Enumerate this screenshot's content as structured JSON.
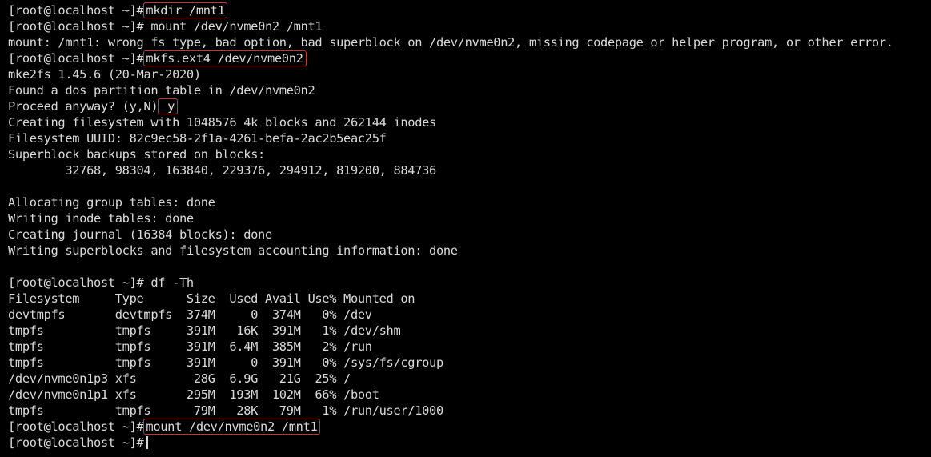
{
  "terminal": {
    "prompt": "[root@localhost ~]#",
    "lines": [
      {
        "type": "cmd",
        "text": "mkdir /mnt1",
        "highlight": true
      },
      {
        "type": "cmd",
        "text": "mount /dev/nvme0n2 /mnt1",
        "highlight": false
      },
      {
        "type": "out",
        "text": "mount: /mnt1: wrong fs type, bad option, bad superblock on /dev/nvme0n2, missing codepage or helper program, or other error."
      },
      {
        "type": "cmd",
        "text": "mkfs.ext4 /dev/nvme0n2",
        "highlight": true
      },
      {
        "type": "out",
        "text": "mke2fs 1.45.6 (20-Mar-2020)"
      },
      {
        "type": "out",
        "text": "Found a dos partition table in /dev/nvme0n2"
      },
      {
        "type": "ask",
        "text": "Proceed anyway? (y,N)",
        "answer": "y"
      },
      {
        "type": "out",
        "text": "Creating filesystem with 1048576 4k blocks and 262144 inodes"
      },
      {
        "type": "out",
        "text": "Filesystem UUID: 82c9ec58-2f1a-4261-befa-2ac2b5eac25f"
      },
      {
        "type": "out",
        "text": "Superblock backups stored on blocks:"
      },
      {
        "type": "out",
        "text": "        32768, 98304, 163840, 229376, 294912, 819200, 884736"
      },
      {
        "type": "out",
        "text": ""
      },
      {
        "type": "out",
        "text": "Allocating group tables: done"
      },
      {
        "type": "out",
        "text": "Writing inode tables: done"
      },
      {
        "type": "out",
        "text": "Creating journal (16384 blocks): done"
      },
      {
        "type": "out",
        "text": "Writing superblocks and filesystem accounting information: done"
      },
      {
        "type": "out",
        "text": ""
      },
      {
        "type": "cmd",
        "text": "df -Th",
        "highlight": false
      },
      {
        "type": "out",
        "text": "Filesystem     Type      Size  Used Avail Use% Mounted on"
      },
      {
        "type": "out",
        "text": "devtmpfs       devtmpfs  374M     0  374M   0% /dev"
      },
      {
        "type": "out",
        "text": "tmpfs          tmpfs     391M   16K  391M   1% /dev/shm"
      },
      {
        "type": "out",
        "text": "tmpfs          tmpfs     391M  6.4M  385M   2% /run"
      },
      {
        "type": "out",
        "text": "tmpfs          tmpfs     391M     0  391M   0% /sys/fs/cgroup"
      },
      {
        "type": "out",
        "text": "/dev/nvme0n1p3 xfs        28G  6.9G   21G  25% /"
      },
      {
        "type": "out",
        "text": "/dev/nvme0n1p1 xfs       295M  193M  102M  66% /boot"
      },
      {
        "type": "out",
        "text": "tmpfs          tmpfs      79M   28K   79M   1% /run/user/1000"
      },
      {
        "type": "cmd",
        "text": "mount /dev/nvme0n2 /mnt1",
        "highlight": true
      },
      {
        "type": "cursor",
        "text": ""
      }
    ]
  }
}
